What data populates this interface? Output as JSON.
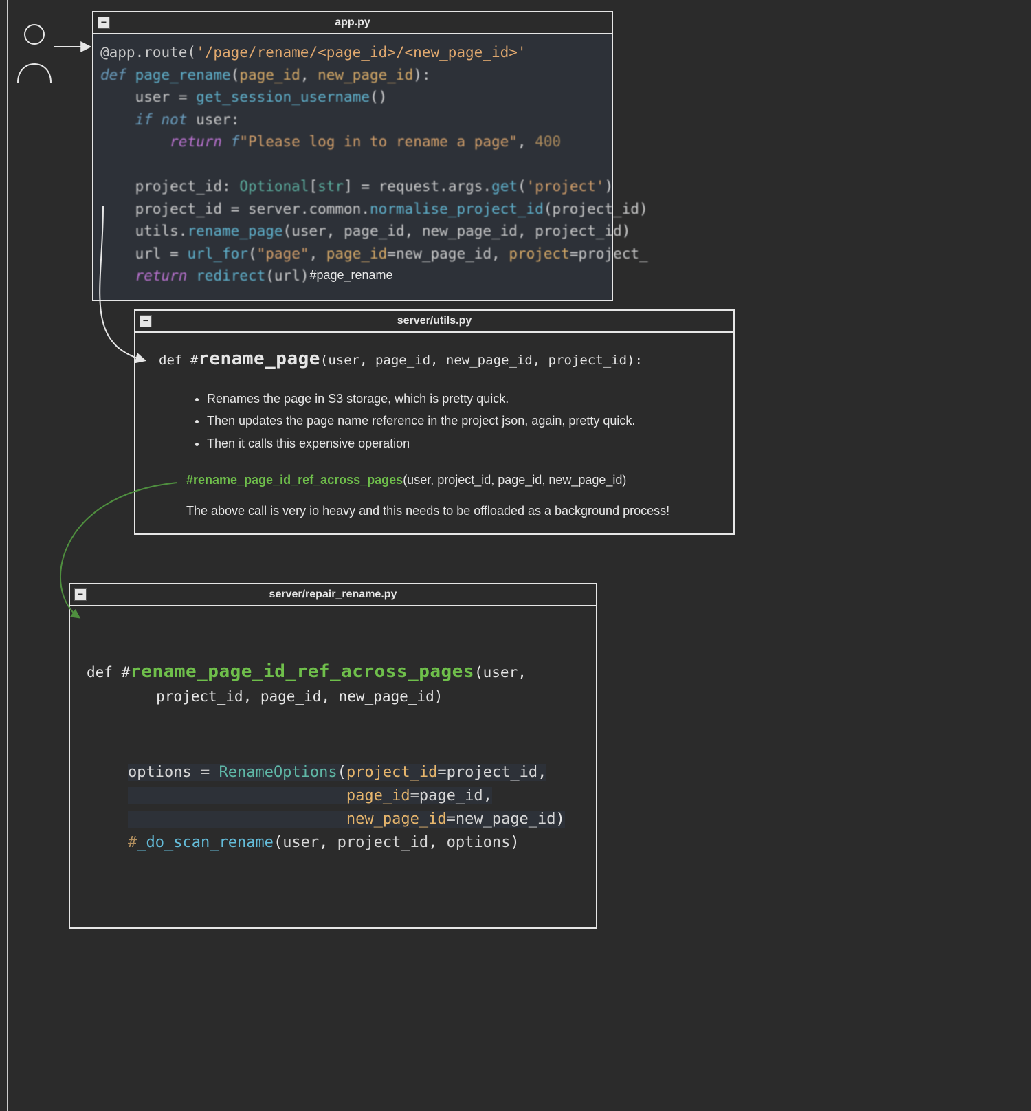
{
  "user_icon_name": "user-icon",
  "panel1": {
    "title": "app.py",
    "caption": "#page_rename",
    "code_lines": [
      {
        "cls": "",
        "html": "<span class='tok-deco'>@app.route(</span><span class='tok-str'>'/page/rename/&lt;page_id&gt;/&lt;new_page_id&gt;'</span>"
      },
      {
        "cls": "blur",
        "html": "<span class='tok-kw'>def</span> <span class='tok-fn'>page_rename</span>(<span class='tok-param'>page_id</span>, <span class='tok-param'>new_page_id</span>):"
      },
      {
        "cls": "blur",
        "html": "    <span class='tok-id'>user</span> <span class='tok-op'>=</span> <span class='tok-fn'>get_session_username</span>()"
      },
      {
        "cls": "blur",
        "html": "    <span class='tok-kw'>if</span> <span class='tok-kw'>not</span> <span class='tok-id'>user</span>:"
      },
      {
        "cls": "blur",
        "html": "        <span class='tok-def'>return</span> <span class='tok-kw'>f</span><span class='tok-str'>\"Please log in to rename a page\"</span>, <span class='tok-acc'>400</span>"
      },
      {
        "cls": "blur",
        "html": " "
      },
      {
        "cls": "blur",
        "html": "    <span class='tok-id'>project_id</span>: <span class='tok-type'>Optional</span>[<span class='tok-type'>str</span>] = <span class='tok-id'>request</span>.<span class='tok-id'>args</span>.<span class='tok-fn'>get</span>(<span class='tok-str'>'project'</span>)"
      },
      {
        "cls": "blur",
        "html": "    <span class='tok-id'>project_id</span> = <span class='tok-id'>server</span>.<span class='tok-id'>common</span>.<span class='tok-fn'>normalise_project_id</span>(<span class='tok-id'>project_id</span>)"
      },
      {
        "cls": "blur",
        "html": "    <span class='tok-id'>utils</span>.<span class='tok-fn'>rename_page</span>(<span class='tok-id'>user</span>, <span class='tok-id'>page_id</span>, <span class='tok-id'>new_page_id</span>, <span class='tok-id'>project_id</span>)"
      },
      {
        "cls": "blur",
        "html": "    <span class='tok-id'>url</span> = <span class='tok-fn'>url_for</span>(<span class='tok-str'>\"page\"</span>, <span class='tok-param'>page_id</span>=<span class='tok-id'>new_page_id</span>, <span class='tok-param'>project</span>=<span class='tok-id'>project_</span>"
      },
      {
        "cls": "blur",
        "html": "    <span class='tok-def'>return</span> <span class='tok-fn'>redirect</span>(<span class='tok-id'>url</span>)"
      }
    ]
  },
  "panel2": {
    "title": "server/utils.py",
    "sig_prefix": "def ",
    "sig_hash": "#",
    "sig_fn": "rename_page",
    "sig_args": "(user, page_id, new_page_id, project_id):",
    "bullets": [
      "Renames the page in S3 storage, which is pretty quick.",
      "Then updates the page name reference in the project json, again, pretty quick.",
      "Then it calls this expensive operation"
    ],
    "call_fn": "#rename_page_id_ref_across_pages",
    "call_args": "(user, project_id, page_id, new_page_id)",
    "note": "The above call is very io heavy and this needs to be offloaded as a background process!"
  },
  "panel3": {
    "title": "server/repair_rename.py",
    "sig_prefix": "def ",
    "sig_hash": "#",
    "sig_fn": "rename_page_id_ref_across_pages",
    "sig_args1": "(user,",
    "sig_args2": "        project_id, page_id, new_page_id)",
    "code": [
      {
        "html": "<span class='hl-bg'><span class='tok-id'>options</span> <span class='tok-op'>=</span> <span class='tok-type'>RenameOptions</span>(<span class='tok-param'>project_id</span><span class='tok-op'>=</span><span class='tok-id'>project_id</span>,</span>"
      },
      {
        "html": "<span class='hl-bg'>                        <span class='tok-param'>page_id</span><span class='tok-op'>=</span><span class='tok-id'>page_id</span>,</span>"
      },
      {
        "html": "<span class='hl-bg'>                        <span class='tok-param'>new_page_id</span><span class='tok-op'>=</span><span class='tok-id'>new_page_id</span>)</span>"
      },
      {
        "html": "<span class='tok-acc'>#</span><span class='tok-fn'>_do_scan_rename</span>(<span class='tok-id'>user</span>, <span class='tok-id'>project_id</span>, <span class='tok-id'>options</span>)"
      }
    ]
  }
}
